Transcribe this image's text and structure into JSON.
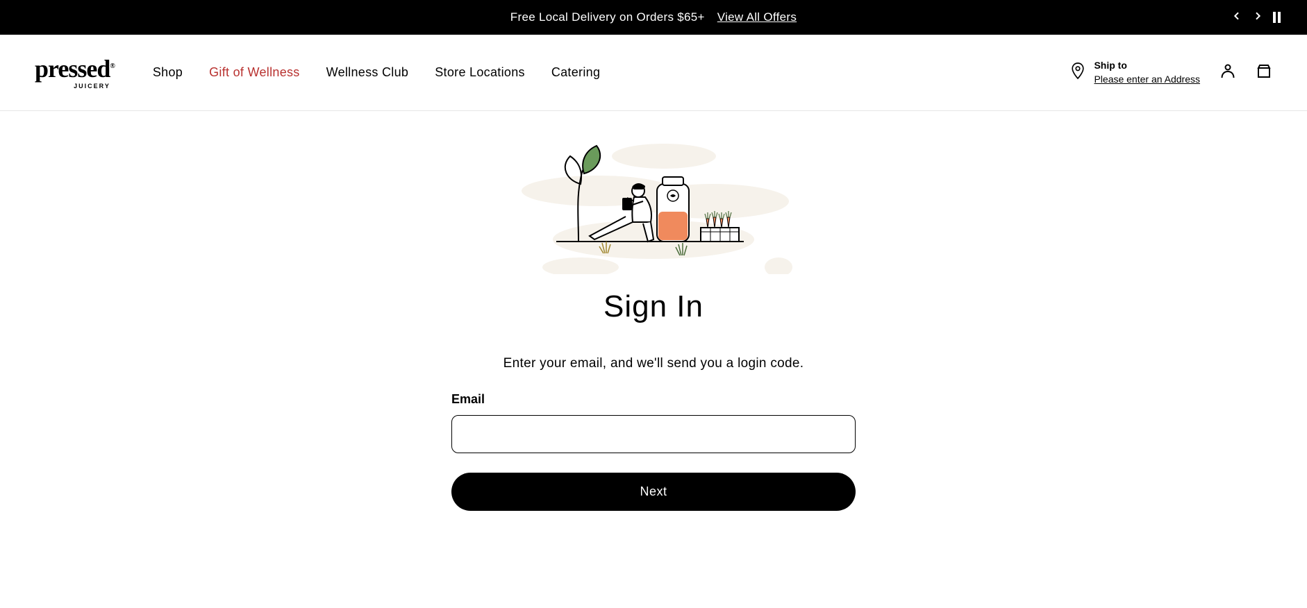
{
  "promo": {
    "text": "Free Local Delivery on Orders $65+",
    "link_label": "View All Offers"
  },
  "logo": {
    "brand": "pressed",
    "sub": "JUICERY"
  },
  "nav": {
    "items": [
      "Shop",
      "Gift of Wellness",
      "Wellness Club",
      "Store Locations",
      "Catering"
    ],
    "highlight_index": 1
  },
  "ship_to": {
    "label": "Ship to",
    "address": "Please enter an Address"
  },
  "signin": {
    "title": "Sign In",
    "subtitle": "Enter your email, and we'll send you a login code.",
    "email_label": "Email",
    "email_value": "",
    "next_label": "Next"
  }
}
